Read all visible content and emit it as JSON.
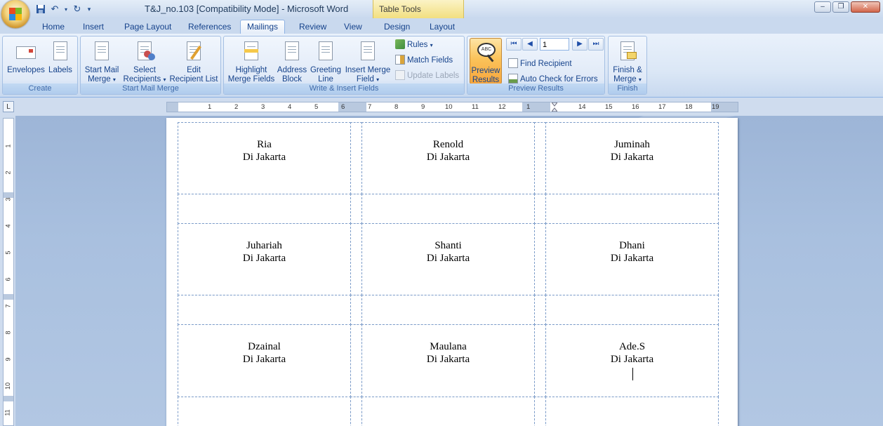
{
  "titlebar": {
    "title": "T&J_no.103 [Compatibility Mode] - Microsoft Word",
    "context_tab_group": "Table Tools"
  },
  "tabs": [
    {
      "label": "Home",
      "active": false
    },
    {
      "label": "Insert",
      "active": false
    },
    {
      "label": "Page Layout",
      "active": false
    },
    {
      "label": "References",
      "active": false
    },
    {
      "label": "Mailings",
      "active": true
    },
    {
      "label": "Review",
      "active": false
    },
    {
      "label": "View",
      "active": false
    },
    {
      "label": "Design",
      "active": false
    },
    {
      "label": "Layout",
      "active": false
    }
  ],
  "ribbon": {
    "create": {
      "label": "Create",
      "envelopes": "Envelopes",
      "labels": "Labels"
    },
    "start_mail_merge": {
      "label": "Start Mail Merge",
      "start_l1": "Start Mail",
      "start_l2": "Merge",
      "select_l1": "Select",
      "select_l2": "Recipients",
      "edit_l1": "Edit",
      "edit_l2": "Recipient List"
    },
    "write_insert": {
      "label": "Write & Insert Fields",
      "highlight_l1": "Highlight",
      "highlight_l2": "Merge Fields",
      "address_l1": "Address",
      "address_l2": "Block",
      "greeting_l1": "Greeting",
      "greeting_l2": "Line",
      "insert_l1": "Insert Merge",
      "insert_l2": "Field",
      "rules": "Rules",
      "match_fields": "Match Fields",
      "update_labels": "Update Labels"
    },
    "preview": {
      "label": "Preview Results",
      "preview_l1": "Preview",
      "preview_l2": "Results",
      "record": "1",
      "find_recipient": "Find Recipient",
      "auto_check": "Auto Check for Errors"
    },
    "finish": {
      "label": "Finish",
      "finish_l1": "Finish &",
      "finish_l2": "Merge"
    }
  },
  "ruler": {
    "h_numbers": [
      "1",
      "2",
      "3",
      "4",
      "5",
      "6",
      "7",
      "8",
      "9",
      "10",
      "11",
      "12",
      "1",
      "14",
      "15",
      "16",
      "17",
      "18",
      "19"
    ],
    "v_numbers": [
      "1",
      "2",
      "3",
      "4",
      "5",
      "6",
      "7",
      "8",
      "9",
      "10",
      "11"
    ]
  },
  "labels": [
    {
      "name": "Ria",
      "city": "Di Jakarta"
    },
    {
      "name": "Renold",
      "city": "Di Jakarta"
    },
    {
      "name": "Juminah",
      "city": "Di Jakarta"
    },
    {
      "name": "Juhariah",
      "city": "Di Jakarta"
    },
    {
      "name": "Shanti",
      "city": "Di Jakarta"
    },
    {
      "name": "Dhani",
      "city": "Di Jakarta"
    },
    {
      "name": "Dzainal",
      "city": "Di Jakarta"
    },
    {
      "name": "Maulana",
      "city": "Di Jakarta"
    },
    {
      "name": "Ade.S",
      "city": "Di Jakarta"
    }
  ],
  "colors": {
    "ribbon_text": "#15428b",
    "active_button": "#fbc35a",
    "cell_border": "#7c9cc9"
  }
}
